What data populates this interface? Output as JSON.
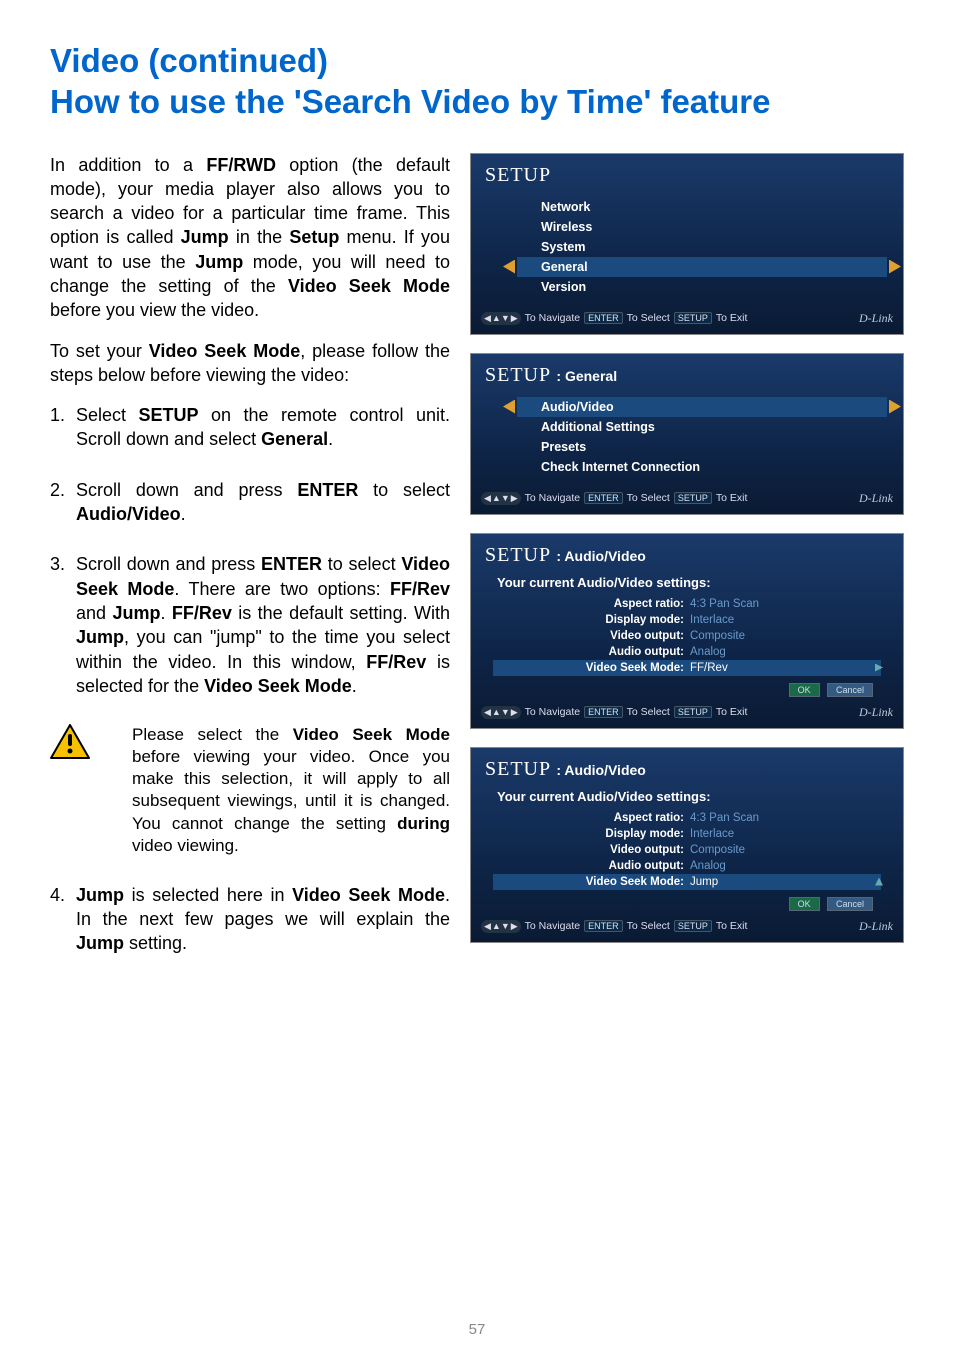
{
  "title_line1": "Video (continued)",
  "title_line2": "How to use the 'Search Video by Time' feature",
  "intro": {
    "pre1": "In addition to a ",
    "b1": "FF/RWD",
    "mid1": " option (the default mode), your media player also allows you to search a video for a particular  time frame. This option is called ",
    "b2": "Jump",
    "mid2": " in the ",
    "b3": "Setup",
    "mid3": " menu. If you want to use the ",
    "b4": "Jump",
    "mid4": " mode, you will need to change the setting of the ",
    "b5": "Video Seek Mode",
    "post": " before you view the video."
  },
  "lead": {
    "pre": "To set your ",
    "b1": "Video Seek Mode",
    "post": ", please follow the steps below before viewing the video:"
  },
  "steps": {
    "s1": {
      "num": "1.",
      "pre": "Select ",
      "b1": "SETUP",
      "mid1": " on the remote control unit. Scroll down and select ",
      "b2": "General",
      "post": "."
    },
    "s2": {
      "num": "2.",
      "pre": "Scroll down and press ",
      "b1": "ENTER",
      "mid1": " to select ",
      "b2": "Audio/Video",
      "post": "."
    },
    "s3": {
      "num": "3.",
      "pre": "Scroll down and press ",
      "b1": "ENTER",
      "mid1": " to select ",
      "b2": "Video Seek Mode",
      "mid2": ". There are two options: ",
      "b3": "FF/Rev",
      "mid3": " and ",
      "b4": "Jump",
      "mid4": ". ",
      "b5": "FF/Rev",
      "mid5": " is the default setting. With ",
      "b6": "Jump",
      "mid6": ", you can \"jump\" to the time you select within the video. In this window, ",
      "b7": "FF/Rev",
      "mid7": " is selected for the ",
      "b8": "Video Seek Mode",
      "post": "."
    },
    "s4": {
      "num": "4.",
      "b1": "Jump",
      "mid1": " is selected here in ",
      "b2": "Video Seek Mode",
      "mid2": ". In the next few pages we will explain the ",
      "b3": "Jump",
      "post": " setting."
    }
  },
  "note": {
    "pre": "Please select the ",
    "b1": "Video Seek Mode",
    "mid1": " before viewing your video. Once you make this selection, it will apply to all subsequent viewings, until it is changed. You cannot change the setting ",
    "b2": "during",
    "post": " video viewing."
  },
  "page_number": "57",
  "footer": {
    "nav": "To Navigate",
    "enter_key": "ENTER",
    "select": "To Select",
    "setup_key": "SETUP",
    "exit": "To Exit",
    "brand": "D-Link"
  },
  "btns": {
    "ok": "OK",
    "cancel": "Cancel"
  },
  "shot1": {
    "title": "SETUP",
    "items": [
      "Network",
      "Wireless",
      "System",
      "General",
      "Version"
    ],
    "selected": 3
  },
  "shot2": {
    "title": "SETUP",
    "sub": ": General",
    "items": [
      "Audio/Video",
      "Additional Settings",
      "Presets",
      "Check Internet Connection"
    ],
    "selected": 0
  },
  "shot3": {
    "title": "SETUP",
    "sub": ": Audio/Video",
    "heading": "Your current Audio/Video settings:",
    "rows": [
      {
        "lbl": "Aspect ratio:",
        "val": "4:3 Pan Scan"
      },
      {
        "lbl": "Display mode:",
        "val": "Interlace"
      },
      {
        "lbl": "Video output:",
        "val": "Composite"
      },
      {
        "lbl": "Audio output:",
        "val": "Analog"
      },
      {
        "lbl": "Video Seek Mode:",
        "val": "FF/Rev"
      }
    ],
    "active": 4
  },
  "shot4": {
    "title": "SETUP",
    "sub": ": Audio/Video",
    "heading": "Your current Audio/Video settings:",
    "rows": [
      {
        "lbl": "Aspect ratio:",
        "val": "4:3 Pan Scan"
      },
      {
        "lbl": "Display mode:",
        "val": "Interlace"
      },
      {
        "lbl": "Video output:",
        "val": "Composite"
      },
      {
        "lbl": "Audio output:",
        "val": "Analog"
      },
      {
        "lbl": "Video Seek Mode:",
        "val": "Jump"
      }
    ],
    "active": 4
  }
}
